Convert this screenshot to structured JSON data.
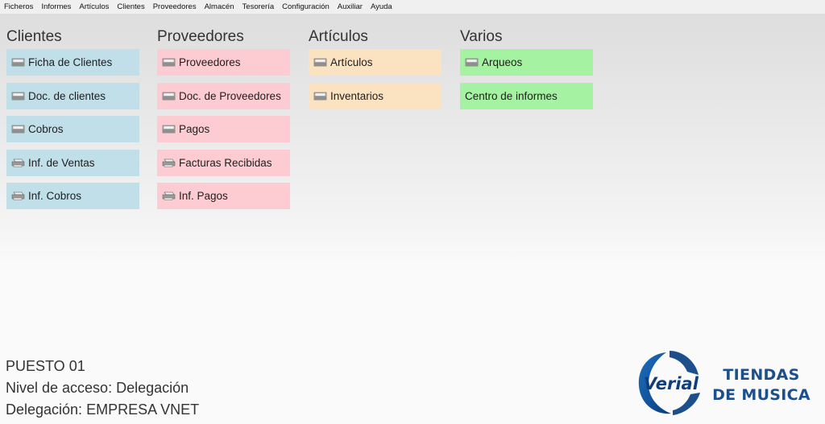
{
  "menubar": [
    "Ficheros",
    "Informes",
    "Artículos",
    "Clientes",
    "Proveedores",
    "Almacén",
    "Tesorería",
    "Configuración",
    "Auxiliar",
    "Ayuda"
  ],
  "colors": {
    "clientes": "#c0dfe9",
    "proveedores": "#fdccd2",
    "articulos": "#fbe3c2",
    "varios": "#a5f2a2",
    "brand": "#1c4f8c"
  },
  "columns": [
    {
      "title": "Clientes",
      "color": "#c0dfe9",
      "items": [
        {
          "label": "Ficha de Clientes",
          "icon": "folder-icon"
        },
        {
          "label": "Doc. de clientes",
          "icon": "folder-icon"
        },
        {
          "label": "Cobros",
          "icon": "folder-icon"
        },
        {
          "label": "Inf. de Ventas",
          "icon": "printer-icon"
        },
        {
          "label": "Inf. Cobros",
          "icon": "printer-icon"
        }
      ]
    },
    {
      "title": "Proveedores",
      "color": "#fdccd2",
      "items": [
        {
          "label": "Proveedores",
          "icon": "folder-icon"
        },
        {
          "label": "Doc. de Proveedores",
          "icon": "folder-icon"
        },
        {
          "label": "Pagos",
          "icon": "folder-icon"
        },
        {
          "label": "Facturas Recibidas",
          "icon": "printer-icon"
        },
        {
          "label": "Inf. Pagos",
          "icon": "printer-icon"
        }
      ]
    },
    {
      "title": "Artículos",
      "color": "#fbe3c2",
      "items": [
        {
          "label": "Artículos",
          "icon": "folder-icon"
        },
        {
          "label": "Inventarios",
          "icon": "folder-icon"
        }
      ]
    },
    {
      "title": "Varios",
      "color": "#a5f2a2",
      "items": [
        {
          "label": "Arqueos",
          "icon": "folder-icon"
        },
        {
          "label": "Centro de informes",
          "icon": ""
        }
      ]
    }
  ],
  "status": {
    "puesto": "PUESTO 01",
    "nivel": "Nivel de acceso: Delegación",
    "delegacion": "Delegación: EMPRESA VNET"
  },
  "logo": {
    "text": "Verial"
  },
  "brand": {
    "line1": "TIENDAS",
    "line2": "DE MUSICA"
  }
}
